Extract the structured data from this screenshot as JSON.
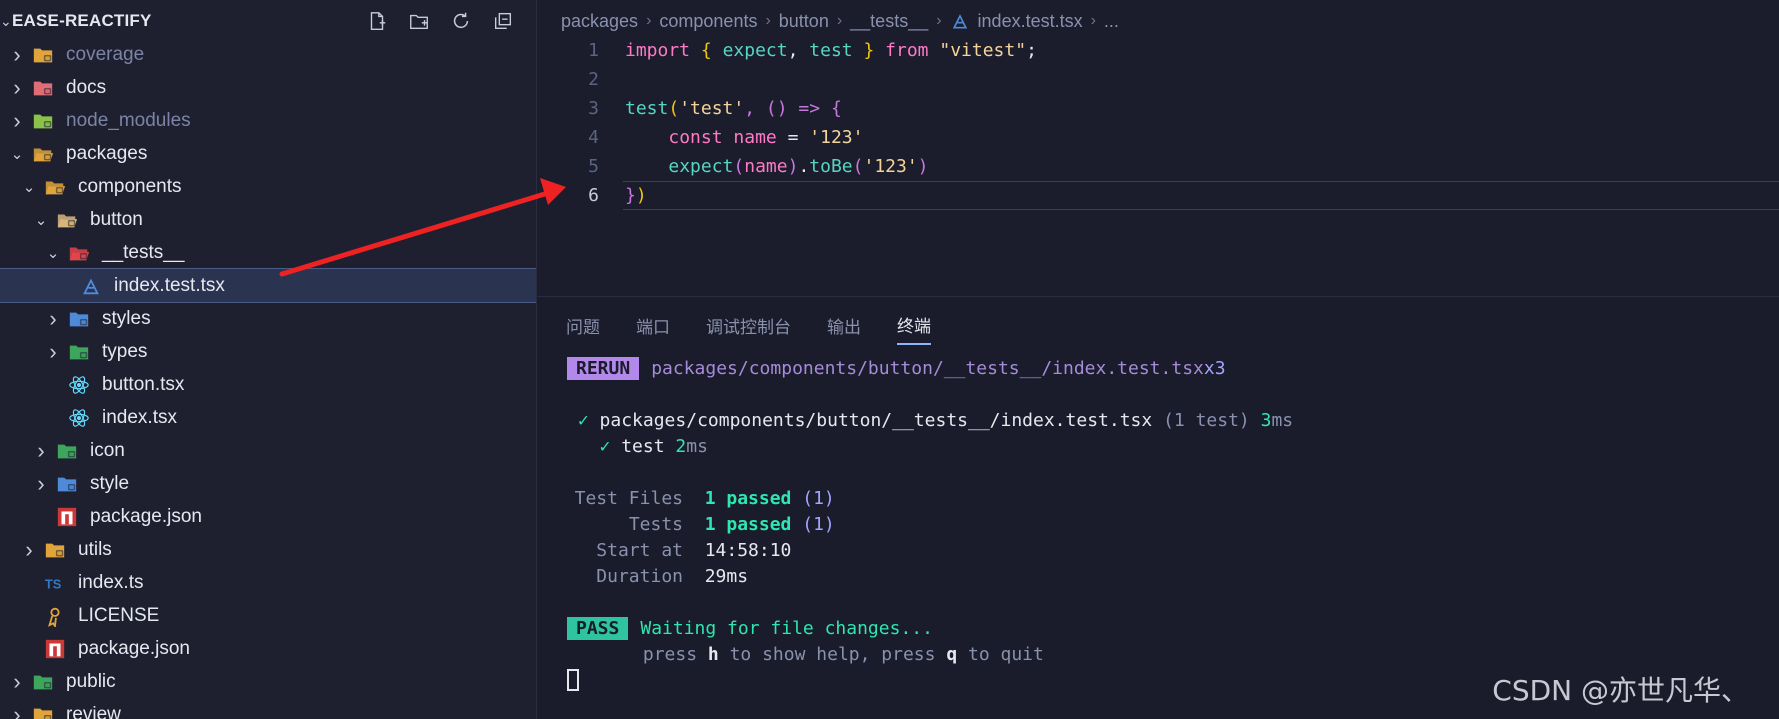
{
  "sidebar": {
    "title": "EASE-REACTIFY",
    "actions": [
      {
        "name": "new-file-icon"
      },
      {
        "name": "new-folder-icon"
      },
      {
        "name": "refresh-icon"
      },
      {
        "name": "collapse-all-icon"
      }
    ],
    "items": [
      {
        "label": "coverage",
        "indent": 0,
        "twisty": "right",
        "icon": "folder-coverage-icon",
        "color": "#e0a43b",
        "dim": true
      },
      {
        "label": "docs",
        "indent": 0,
        "twisty": "right",
        "icon": "folder-docs-icon",
        "color": "#e06c75",
        "dim": false
      },
      {
        "label": "node_modules",
        "indent": 0,
        "twisty": "right",
        "icon": "folder-node-icon",
        "color": "#8bc34a",
        "dim": true
      },
      {
        "label": "packages",
        "indent": 0,
        "twisty": "down",
        "icon": "folder-packages-open-icon",
        "color": "#e0a43b",
        "dim": false
      },
      {
        "label": "components",
        "indent": 1,
        "twisty": "down",
        "icon": "folder-components-open-icon",
        "color": "#e0a43b",
        "dim": false
      },
      {
        "label": "button",
        "indent": 2,
        "twisty": "down",
        "icon": "folder-open-icon",
        "color": "#d9b77c",
        "dim": false
      },
      {
        "label": "__tests__",
        "indent": 3,
        "twisty": "down",
        "icon": "folder-tests-open-icon",
        "color": "#e0454a",
        "dim": false
      },
      {
        "label": "index.test.tsx",
        "indent": 4,
        "twisty": "none",
        "icon": "test-file-icon",
        "color": "#4f8ad9",
        "dim": false,
        "selected": true
      },
      {
        "label": "styles",
        "indent": 3,
        "twisty": "right",
        "icon": "folder-styles-icon",
        "color": "#4f8ad9",
        "dim": false
      },
      {
        "label": "types",
        "indent": 3,
        "twisty": "right",
        "icon": "folder-types-icon",
        "color": "#3ea55c",
        "dim": false
      },
      {
        "label": "button.tsx",
        "indent": 3,
        "twisty": "none",
        "icon": "react-icon",
        "color": "#61dafb",
        "dim": false
      },
      {
        "label": "index.tsx",
        "indent": 3,
        "twisty": "none",
        "icon": "react-icon",
        "color": "#61dafb",
        "dim": false
      },
      {
        "label": "icon",
        "indent": 2,
        "twisty": "right",
        "icon": "folder-image-icon",
        "color": "#3ea55c",
        "dim": false
      },
      {
        "label": "style",
        "indent": 2,
        "twisty": "right",
        "icon": "folder-styles-icon",
        "color": "#4f8ad9",
        "dim": false
      },
      {
        "label": "package.json",
        "indent": 2,
        "twisty": "none",
        "icon": "npm-icon",
        "color": "#cb3837",
        "dim": false
      },
      {
        "label": "utils",
        "indent": 1,
        "twisty": "right",
        "icon": "folder-utils-icon",
        "color": "#e0a43b",
        "dim": false
      },
      {
        "label": "index.ts",
        "indent": 1,
        "twisty": "none",
        "icon": "typescript-icon",
        "color": "#3178c6",
        "dim": false
      },
      {
        "label": "LICENSE",
        "indent": 1,
        "twisty": "none",
        "icon": "license-icon",
        "color": "#e0a43b",
        "dim": false
      },
      {
        "label": "package.json",
        "indent": 1,
        "twisty": "none",
        "icon": "npm-icon",
        "color": "#cb3837",
        "dim": false
      },
      {
        "label": "public",
        "indent": 0,
        "twisty": "right",
        "icon": "folder-public-icon",
        "color": "#3ea55c",
        "dim": false
      },
      {
        "label": "review",
        "indent": 0,
        "twisty": "right",
        "icon": "folder-review-icon",
        "color": "#e0a43b",
        "dim": false
      }
    ]
  },
  "editor": {
    "breadcrumb": [
      "packages",
      "components",
      "button",
      "__tests__",
      "index.test.tsx",
      "..."
    ],
    "line_numbers": [
      "1",
      "2",
      "3",
      "4",
      "5",
      "6"
    ],
    "active_line": "6",
    "code": {
      "l1": {
        "kw": "import",
        "b1": "{",
        "a": "expect",
        "comma": ",",
        "b": "test",
        "b2": "}",
        "from": "from",
        "src": "\"vitest\"",
        "semi": ";"
      },
      "l3": {
        "fn": "test",
        "p1": "(",
        "str": "'test'",
        "rest": ", () => ",
        "b": "{"
      },
      "l4": {
        "kw": "const",
        "name": "name",
        "eq": " = ",
        "val": "'123'"
      },
      "l5": {
        "fn": "expect",
        "p1": "(",
        "name": "name",
        "p2": ")",
        "dot": ".",
        "m": "toBe",
        "p3": "(",
        "val": "'123'",
        "p4": ")"
      },
      "l6": {
        "b": "}",
        "p": ")"
      }
    }
  },
  "panel": {
    "tabs": [
      "问题",
      "端口",
      "调试控制台",
      "输出",
      "终端"
    ],
    "active_tab": "终端",
    "terminal": {
      "rerun_badge": "RERUN",
      "rerun_path": "packages/components/button/__tests__/index.test.tsx",
      "rerun_count": "x3",
      "check": "✓",
      "file_path": "packages/components/button/__tests__/index.test.tsx",
      "file_count": "(1 test)",
      "file_time_num": "3",
      "file_time_unit": "ms",
      "test_name": "test",
      "test_time_num": "2",
      "test_time_unit": "ms",
      "summary": [
        {
          "label": "Test Files",
          "value": "1 passed",
          "extra": "(1)"
        },
        {
          "label": "Tests",
          "value": "1 passed",
          "extra": "(1)"
        },
        {
          "label": "Start at",
          "value": "14:58:10",
          "extra": ""
        },
        {
          "label": "Duration",
          "value": "29ms",
          "extra": ""
        }
      ],
      "pass_badge": "PASS",
      "waiting": "Waiting for file changes...",
      "hint": {
        "press1": "press ",
        "key1": "h",
        "mid": " to show help, press ",
        "key2": "q",
        "end": " to quit"
      }
    }
  },
  "watermark": "CSDN @亦世凡华、",
  "colors": {
    "accent": "#8fb4ff",
    "arrow": "#ee2222",
    "pass": "#2ec4a0",
    "rerun": "#b388eb"
  }
}
